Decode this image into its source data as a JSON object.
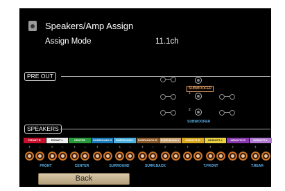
{
  "header": {
    "title": "Speakers/Amp Assign",
    "icon": "speaker-icon"
  },
  "assign_mode": {
    "label": "Assign Mode",
    "value": "11.1ch"
  },
  "pre_out": {
    "label": "PRE OUT",
    "subwoofer_1": {
      "number": "1",
      "box_label": "SUBWOOFER"
    },
    "subwoofer_2": {
      "number": "2",
      "label": "SUBWOOFER"
    }
  },
  "speakers": {
    "label": "SPEAKERS",
    "channel_strip": [
      {
        "text": "FRONT R",
        "color": "#c8102e"
      },
      {
        "text": "FRONT L",
        "color": "#f0f0f0"
      },
      {
        "text": "CENTER",
        "color": "#2a9a3a"
      },
      {
        "text": "SURROUND R",
        "color": "#1a7ab8"
      },
      {
        "text": "SURROUND L",
        "color": "#4ab0e0"
      },
      {
        "text": "SURR.BACK R",
        "color": "#8a5a2a"
      },
      {
        "text": "SURR.BACK L",
        "color": "#c8a070"
      },
      {
        "text": "HEIGHT1 R",
        "color": "#d8a820"
      },
      {
        "text": "HEIGHT1 L",
        "color": "#e8d040"
      },
      {
        "text": "HEIGHT2 R",
        "color": "#8a3ab0"
      },
      {
        "text": "HEIGHT2 L",
        "color": "#b07ad0"
      }
    ],
    "zone_labels": [
      "FRONT",
      "CENTER",
      "SURROUND",
      "SURR.BACK",
      "T.FRONT",
      "T.REAR"
    ],
    "terminal_marks": [
      "+",
      "−"
    ]
  },
  "back_button": {
    "label": "Back"
  }
}
